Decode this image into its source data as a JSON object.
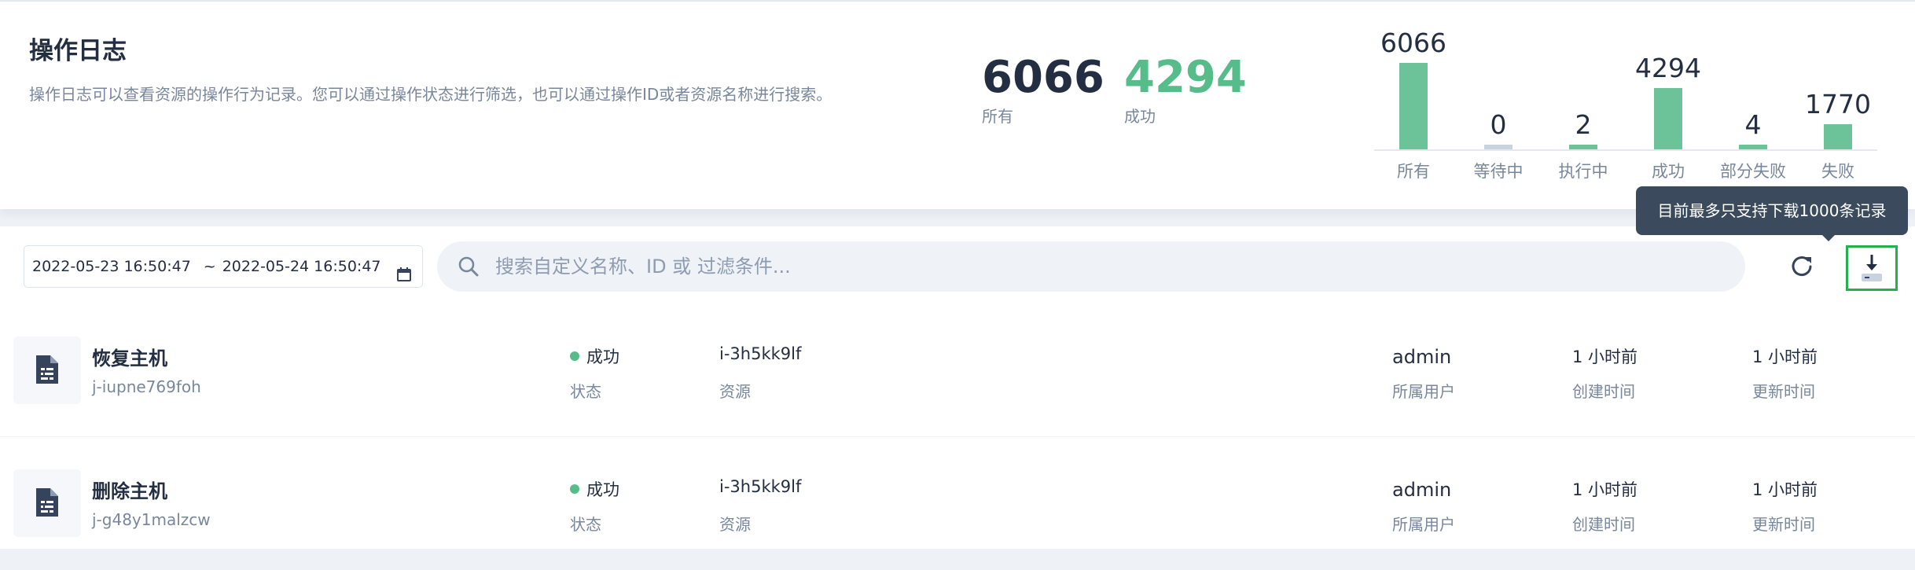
{
  "header": {
    "title": "操作日志",
    "description": "操作日志可以查看资源的操作行为记录。您可以通过操作状态进行筛选，也可以通过操作ID或者资源名称进行搜索。",
    "stats": [
      {
        "value": "6066",
        "label": "所有"
      },
      {
        "value": "4294",
        "label": "成功"
      }
    ]
  },
  "chart_data": {
    "type": "bar",
    "categories": [
      "所有",
      "等待中",
      "执行中",
      "成功",
      "部分失败",
      "失败"
    ],
    "values": [
      6066,
      0,
      2,
      4294,
      4,
      1770
    ],
    "value_labels": [
      "6066",
      "0",
      "2",
      "4294",
      "4",
      "1770"
    ],
    "colors": {
      "bar": "#6cc39a",
      "zero_bar": "#c9d3e0"
    }
  },
  "tooltip": {
    "text": "目前最多只支持下载1000条记录"
  },
  "toolbar": {
    "date_start": "2022-05-23 16:50:47",
    "date_sep": "~",
    "date_end": "2022-05-24 16:50:47",
    "search_placeholder": "搜索自定义名称、ID 或 过滤条件..."
  },
  "rows": [
    {
      "name": "恢复主机",
      "id": "j-iupne769foh",
      "status": "成功",
      "status_label": "状态",
      "resource": "i-3h5kk9lf",
      "resource_label": "资源",
      "user": "admin",
      "user_label": "所属用户",
      "created": "1 小时前",
      "created_label": "创建时间",
      "updated": "1 小时前",
      "updated_label": "更新时间"
    },
    {
      "name": "删除主机",
      "id": "j-g48y1malzcw",
      "status": "成功",
      "status_label": "状态",
      "resource": "i-3h5kk9lf",
      "resource_label": "资源",
      "user": "admin",
      "user_label": "所属用户",
      "created": "1 小时前",
      "created_label": "创建时间",
      "updated": "1 小时前",
      "updated_label": "更新时间"
    }
  ],
  "colors": {
    "accent_green": "#55bc8a",
    "text_dark": "#242e42",
    "text_muted": "#79879c"
  },
  "icons": [
    "calendar-icon",
    "search-icon",
    "refresh-icon",
    "download-icon",
    "document-icon"
  ]
}
